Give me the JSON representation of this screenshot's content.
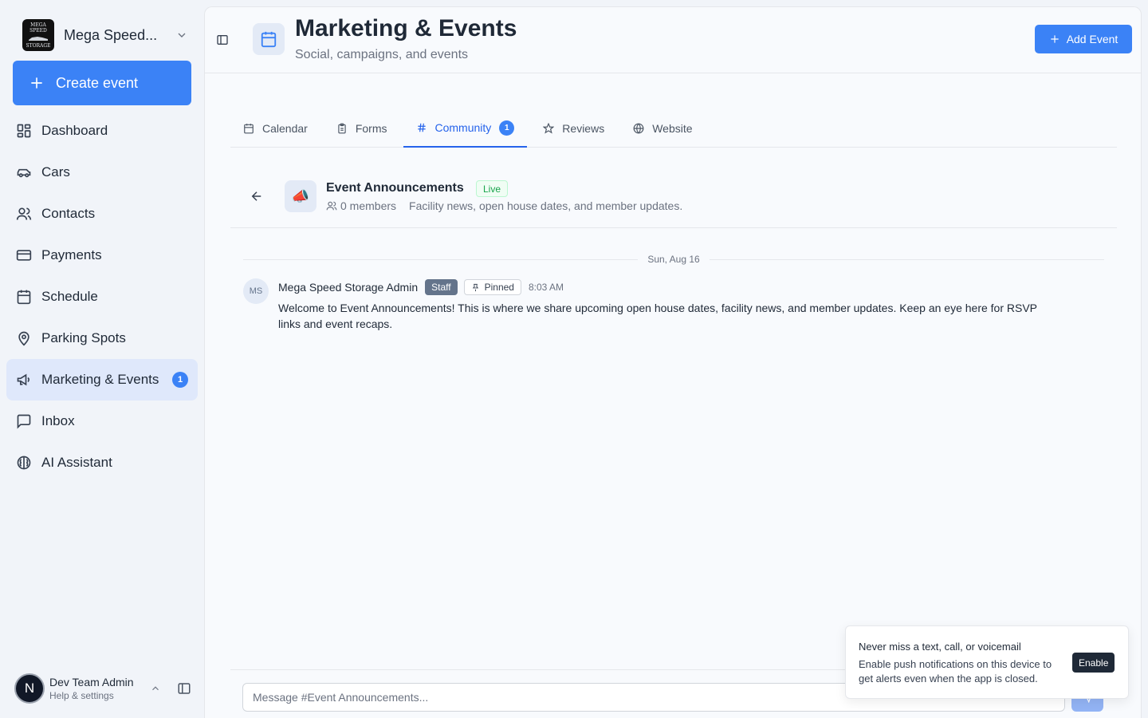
{
  "org": {
    "name": "Mega Speed...",
    "logo_text_top": "MEGA SPEED",
    "logo_text_bottom": "STORAGE"
  },
  "sidebar": {
    "create_label": "Create event",
    "items": [
      {
        "label": "Dashboard",
        "icon": "dashboard-icon"
      },
      {
        "label": "Cars",
        "icon": "car-icon"
      },
      {
        "label": "Contacts",
        "icon": "users-icon"
      },
      {
        "label": "Payments",
        "icon": "credit-card-icon"
      },
      {
        "label": "Schedule",
        "icon": "calendar-icon"
      },
      {
        "label": "Parking Spots",
        "icon": "map-pin-icon"
      },
      {
        "label": "Marketing & Events",
        "icon": "megaphone-icon",
        "badge": "1",
        "active": true
      },
      {
        "label": "Inbox",
        "icon": "message-square-icon"
      },
      {
        "label": "AI Assistant",
        "icon": "brain-icon"
      }
    ]
  },
  "user": {
    "initial": "N",
    "name": "Dev Team Admin",
    "subtitle": "Help & settings"
  },
  "header": {
    "title": "Marketing & Events",
    "subtitle": "Social, campaigns, and events",
    "add_label": "Add Event"
  },
  "tabs": [
    {
      "label": "Calendar",
      "icon": "calendar-icon"
    },
    {
      "label": "Forms",
      "icon": "clipboard-icon"
    },
    {
      "label": "Community",
      "icon": "hash-icon",
      "badge": "1",
      "active": true
    },
    {
      "label": "Reviews",
      "icon": "star-icon"
    },
    {
      "label": "Website",
      "icon": "globe-icon"
    }
  ],
  "channel": {
    "emoji": "📣",
    "name": "Event Announcements",
    "status": "Live",
    "members": "0 members",
    "description": "Facility news, open house dates, and member updates."
  },
  "date_separator": "Sun, Aug 16",
  "message": {
    "avatar": "MS",
    "author": "Mega Speed Storage Admin",
    "role": "Staff",
    "pinned_label": "Pinned",
    "time": "8:03 AM",
    "body": "Welcome to Event Announcements! This is where we share upcoming open house dates, facility news, and member updates. Keep an eye here for RSVP links and event recaps."
  },
  "composer": {
    "placeholder": "Message #Event Announcements..."
  },
  "toast": {
    "title": "Never miss a text, call, or voicemail",
    "body": "Enable push notifications on this device to get alerts even when the app is closed.",
    "button": "Enable"
  },
  "colors": {
    "accent": "#3b82f6",
    "live": "#16a34a",
    "staff": "#64748b"
  }
}
